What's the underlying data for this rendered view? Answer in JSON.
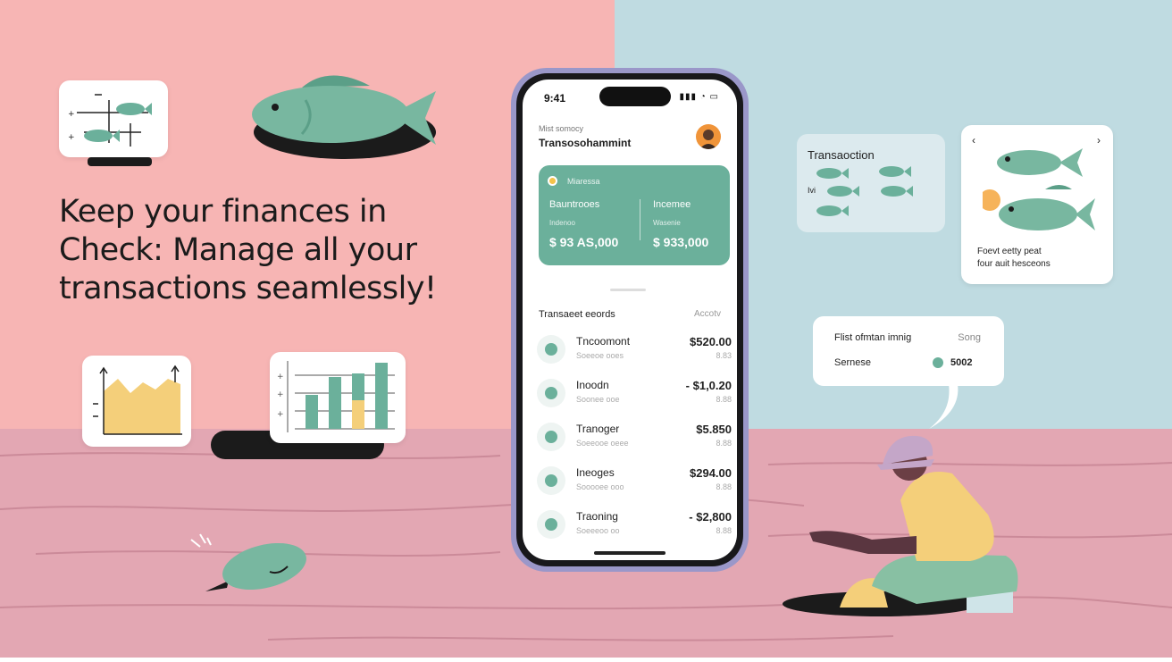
{
  "headline": "Keep your finances in Check: Manage all your transactions seamlessly!",
  "phone": {
    "time": "9:41",
    "status_icons": "▮▮▮ ◔ ▭",
    "subtitle": "Mist somocy",
    "title": "Transosohammint",
    "balance_card": {
      "top_label": "Miaressa",
      "left": {
        "label": "Bauntrooes",
        "sub": "Indenoo",
        "amount": "$ 93 AS,000"
      },
      "right": {
        "label": "Incemee",
        "sub": "Wasenie",
        "amount": "$ 933,000"
      }
    },
    "section_title": "Transaeet eeords",
    "section_action": "Accotv",
    "transactions": [
      {
        "name": "Tncoomont",
        "sub": "Soeeoe ooes",
        "amount": "$520.00",
        "amount_sub": "8.83"
      },
      {
        "name": "Inoodn",
        "sub": "Soonee ooe",
        "amount": "- $1,0.20",
        "amount_sub": "8.88"
      },
      {
        "name": "Tranoger",
        "sub": "Soeeooe oeee",
        "amount": "$5.850",
        "amount_sub": "8.88"
      },
      {
        "name": "Ineoges",
        "sub": "Sooooee ooo",
        "amount": "$294.00",
        "amount_sub": "8.88"
      },
      {
        "name": "Traoning",
        "sub": "Soeeeoo oo",
        "amount": "- $2,800",
        "amount_sub": "8.88"
      }
    ]
  },
  "transaction_card": {
    "title": "Transaoction",
    "label": "Ivi"
  },
  "fish_card": {
    "line1": "Foevt eetty peat",
    "line2": "four auit hesceons"
  },
  "chip": {
    "row1_left": "Flist ofmtan imnig",
    "row1_right": "Song",
    "row2_left": "Sernese",
    "row2_right": "5002"
  },
  "colors": {
    "teal": "#6bb09b",
    "pink_bg": "#f7b5b4",
    "blue_bg": "#bfdbe1",
    "floor": "#e3a7b3",
    "yellow": "#f4cf7a"
  }
}
